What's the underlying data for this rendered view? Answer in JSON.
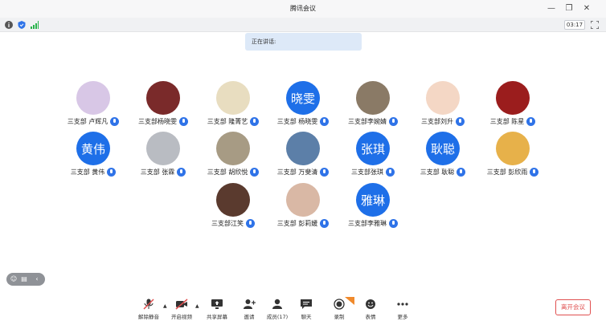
{
  "window": {
    "title": "腾讯会议"
  },
  "status": {
    "timer": "03:17"
  },
  "speaking": {
    "label": "正在讲话:"
  },
  "participants": [
    {
      "name": "三支部 卢辉凡",
      "avatar_text": "",
      "avatar_color": "#d8c7e6"
    },
    {
      "name": "三支部杨晓雯",
      "avatar_text": "",
      "avatar_color": "#7a2a2a"
    },
    {
      "name": "三支部 隆菁艺",
      "avatar_text": "",
      "avatar_color": "#e8ddc0"
    },
    {
      "name": "三支部 杨晓雯",
      "avatar_text": "晓雯",
      "avatar_color": "#1e6fe8"
    },
    {
      "name": "三支部李婉婧",
      "avatar_text": "",
      "avatar_color": "#8a7a66"
    },
    {
      "name": "三支部刘升",
      "avatar_text": "",
      "avatar_color": "#f4d7c5"
    },
    {
      "name": "三支部 陈星",
      "avatar_text": "",
      "avatar_color": "#9b1d1d"
    },
    {
      "name": "三支部 黄伟",
      "avatar_text": "黄伟",
      "avatar_color": "#1e6fe8"
    },
    {
      "name": "三支部 张霖",
      "avatar_text": "",
      "avatar_color": "#b9bcc2"
    },
    {
      "name": "三支部 胡欣悦",
      "avatar_text": "",
      "avatar_color": "#a79b84"
    },
    {
      "name": "三支部 万斐清",
      "avatar_text": "",
      "avatar_color": "#5c7fa8"
    },
    {
      "name": "三支部张琪",
      "avatar_text": "张琪",
      "avatar_color": "#1e6fe8"
    },
    {
      "name": "三支部 耿聪",
      "avatar_text": "耿聪",
      "avatar_color": "#1e6fe8"
    },
    {
      "name": "三支部 彭欣雨",
      "avatar_text": "",
      "avatar_color": "#e7b14a"
    },
    {
      "name": "三支部江笑",
      "avatar_text": "",
      "avatar_color": "#5a3a2e"
    },
    {
      "name": "三支部 彭莉媛",
      "avatar_text": "",
      "avatar_color": "#d9b8a5"
    },
    {
      "name": "三支部李雅琳",
      "avatar_text": "雅琳",
      "avatar_color": "#1e6fe8"
    }
  ],
  "toolbar": {
    "mute": "解除静音",
    "video": "开启视频",
    "share": "共享屏幕",
    "invite": "邀请",
    "members": "成员(17)",
    "chat": "聊天",
    "record": "录制",
    "emoji": "表情",
    "more": "更多"
  },
  "leave": "离开会议",
  "colors": {
    "accent": "#1e6fe8",
    "danger": "#e04f4f"
  }
}
